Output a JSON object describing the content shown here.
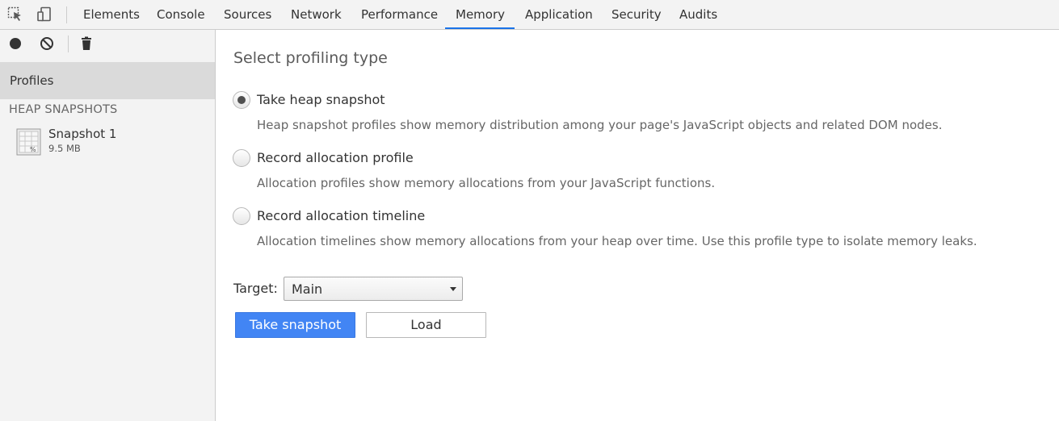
{
  "tabs": [
    {
      "label": "Elements"
    },
    {
      "label": "Console"
    },
    {
      "label": "Sources"
    },
    {
      "label": "Network"
    },
    {
      "label": "Performance"
    },
    {
      "label": "Memory",
      "active": true
    },
    {
      "label": "Application"
    },
    {
      "label": "Security"
    },
    {
      "label": "Audits"
    }
  ],
  "toolbar_icons": [
    "inspect-element-icon",
    "device-toolbar-icon"
  ],
  "sidebar": {
    "toolbar_icons": [
      "record-icon",
      "clear-icon",
      "trash-icon"
    ],
    "profiles_label": "Profiles",
    "section_header": "HEAP SNAPSHOTS",
    "snapshots": [
      {
        "title": "Snapshot 1",
        "size": "9.5 MB"
      }
    ]
  },
  "main": {
    "title": "Select profiling type",
    "options": [
      {
        "label": "Take heap snapshot",
        "description": "Heap snapshot profiles show memory distribution among your page's JavaScript objects and related DOM nodes.",
        "checked": true
      },
      {
        "label": "Record allocation profile",
        "description": "Allocation profiles show memory allocations from your JavaScript functions.",
        "checked": false
      },
      {
        "label": "Record allocation timeline",
        "description": "Allocation timelines show memory allocations from your heap over time. Use this profile type to isolate memory leaks.",
        "checked": false
      }
    ],
    "target_label": "Target:",
    "target_value": "Main",
    "primary_button": "Take snapshot",
    "secondary_button": "Load"
  },
  "colors": {
    "accent": "#4285f4",
    "tab_underline": "#1a73e8",
    "sidebar_bg": "#f3f3f3",
    "selected_bg": "#dadada"
  }
}
